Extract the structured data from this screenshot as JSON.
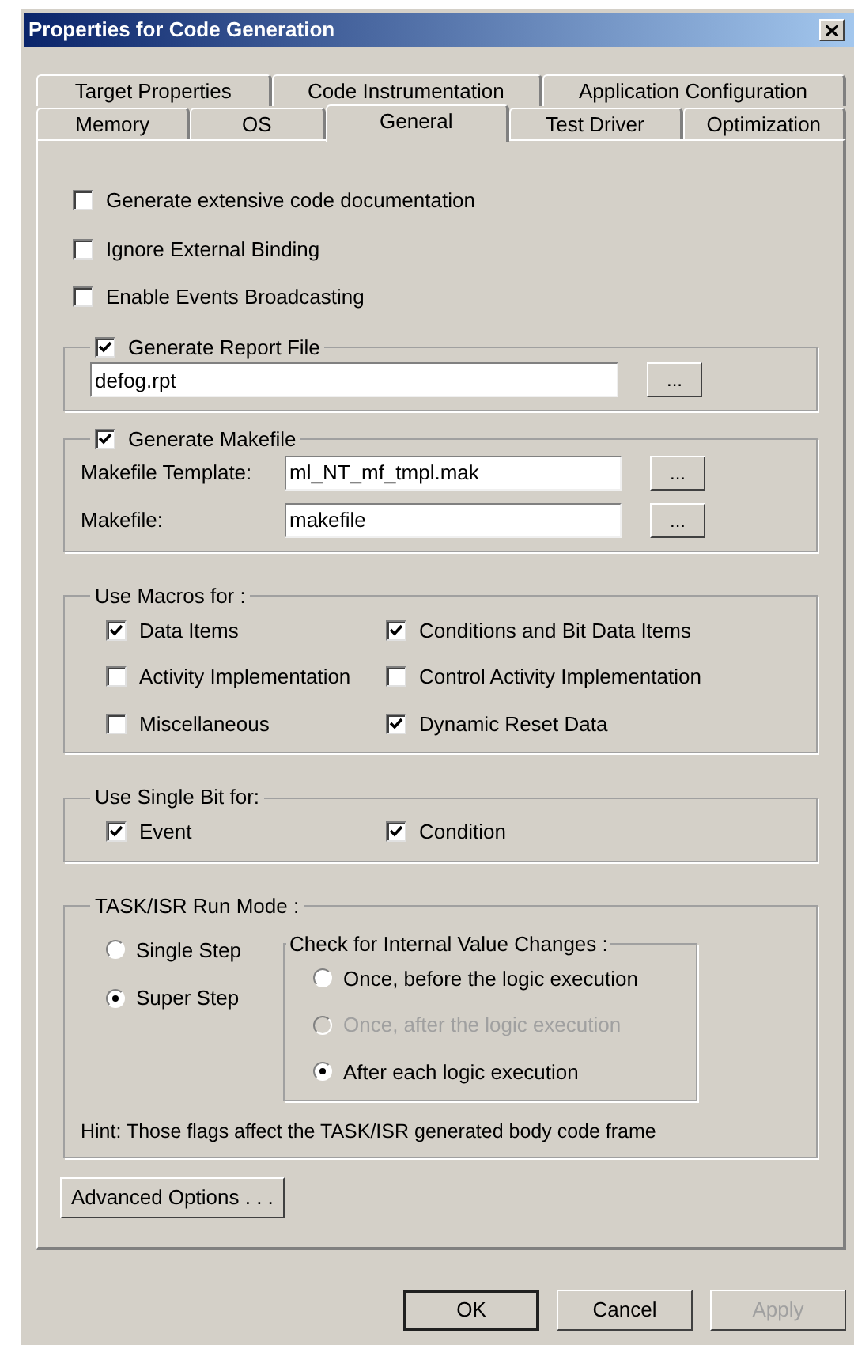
{
  "window": {
    "title": "Properties for Code Generation"
  },
  "tab_rows": [
    [
      {
        "label": "Target Properties",
        "selected": false
      },
      {
        "label": "Code Instrumentation",
        "selected": false
      },
      {
        "label": "Application Configuration",
        "selected": false
      }
    ],
    [
      {
        "label": "Memory",
        "selected": false
      },
      {
        "label": "OS",
        "selected": false
      },
      {
        "label": "General",
        "selected": true
      },
      {
        "label": "Test Driver",
        "selected": false
      },
      {
        "label": "Optimization",
        "selected": false
      }
    ]
  ],
  "options": [
    {
      "label": "Generate extensive code documentation",
      "checked": false
    },
    {
      "label": "Ignore External Binding",
      "checked": false
    },
    {
      "label": "Enable Events Broadcasting",
      "checked": false
    }
  ],
  "report_group": {
    "label": "Generate Report File",
    "checked": true,
    "value": "defog.rpt",
    "browse": "..."
  },
  "makefile_group": {
    "label": "Generate Makefile",
    "checked": true,
    "fields": [
      {
        "label": "Makefile Template:",
        "value": "ml_NT_mf_tmpl.mak",
        "browse": "..."
      },
      {
        "label": "Makefile:",
        "value": "makefile",
        "browse": "..."
      }
    ]
  },
  "macros_group": {
    "title": "Use Macros for :",
    "items": [
      {
        "label": "Data Items",
        "checked": true
      },
      {
        "label": "Conditions and Bit Data Items",
        "checked": true
      },
      {
        "label": "Activity Implementation",
        "checked": false
      },
      {
        "label": "Control Activity Implementation",
        "checked": false
      },
      {
        "label": "Miscellaneous",
        "checked": false
      },
      {
        "label": "Dynamic Reset Data",
        "checked": true
      }
    ]
  },
  "single_bit_group": {
    "title": "Use Single Bit for:",
    "items": [
      {
        "label": "Event",
        "checked": true
      },
      {
        "label": "Condition",
        "checked": true
      }
    ]
  },
  "run_mode_group": {
    "title": "TASK/ISR Run Mode :",
    "modes": [
      {
        "label": "Single Step",
        "selected": false
      },
      {
        "label": "Super Step",
        "selected": true
      }
    ],
    "check_group": {
      "title": "Check for Internal Value Changes :",
      "options": [
        {
          "label": "Once, before the logic execution",
          "selected": false,
          "disabled": false
        },
        {
          "label": "Once, after the logic execution",
          "selected": false,
          "disabled": true
        },
        {
          "label": "After each logic execution",
          "selected": true,
          "disabled": false
        }
      ]
    },
    "hint": "Hint: Those flags affect the TASK/ISR generated body code frame"
  },
  "advanced_button": "Advanced Options . . .",
  "buttons": [
    {
      "label": "OK",
      "disabled": false,
      "default": true
    },
    {
      "label": "Cancel",
      "disabled": false,
      "default": false
    },
    {
      "label": "Apply",
      "disabled": true,
      "default": false
    }
  ]
}
